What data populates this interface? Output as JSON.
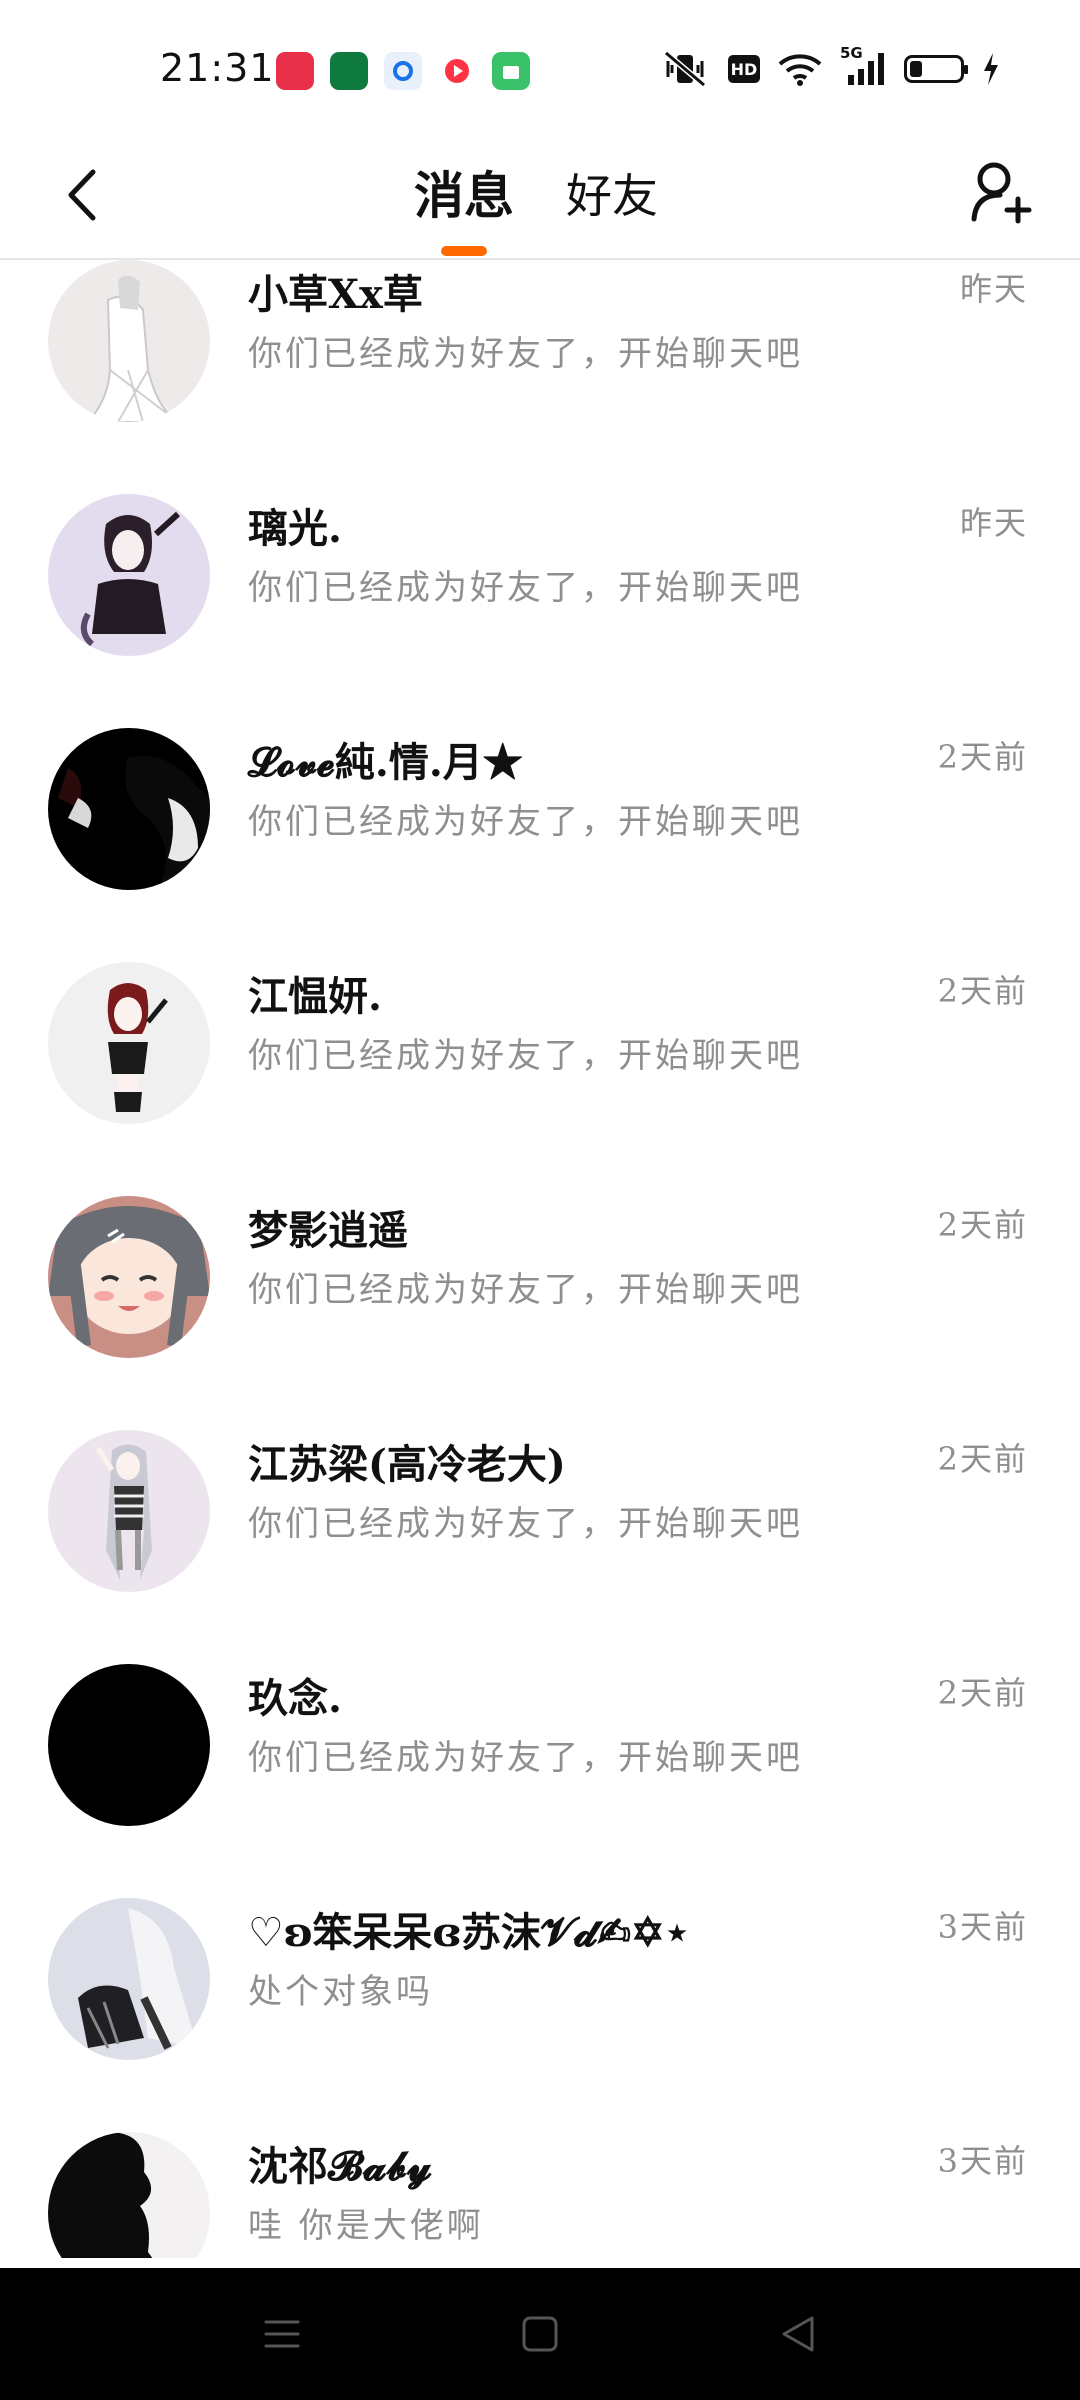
{
  "status_bar": {
    "time": "21:31",
    "app_icons": [
      {
        "name": "xiaohongshu-icon",
        "color": "#e8304a",
        "label": "小红书"
      },
      {
        "name": "oppo-icon",
        "color": "#0e7a3e",
        "label": "OPPO"
      },
      {
        "name": "qq-browser-icon",
        "color": "#e8f0fb",
        "label": ""
      },
      {
        "name": "video-app-icon",
        "color": "#ff3344",
        "label": ""
      },
      {
        "name": "app-store-icon",
        "color": "#39c26a",
        "label": ""
      }
    ],
    "network": "5G",
    "hd": "HD"
  },
  "header": {
    "tab_messages": "消息",
    "tab_friends": "好友",
    "accent_color": "#ff6a00"
  },
  "conversations": [
    {
      "name": "小草Xx草",
      "preview": "你们已经成为好友了，开始聊天吧",
      "time": "昨天"
    },
    {
      "name": "璃光.",
      "preview": "你们已经成为好友了，开始聊天吧",
      "time": "昨天"
    },
    {
      "name": "𝓛𝓸𝓿𝓮純.情.月★",
      "preview": "你们已经成为好友了，开始聊天吧",
      "time": "2天前"
    },
    {
      "name": "江愠妍.",
      "preview": "你们已经成为好友了，开始聊天吧",
      "time": "2天前"
    },
    {
      "name": "梦影逍遥",
      "preview": "你们已经成为好友了，开始聊天吧",
      "time": "2天前"
    },
    {
      "name": "江苏梁(高冷老大)",
      "preview": "你们已经成为好友了，开始聊天吧",
      "time": "2天前"
    },
    {
      "name": "玖念.",
      "preview": "你们已经成为好友了，开始聊天吧",
      "time": "2天前"
    },
    {
      "name": "♡ʚ笨呆呆ɞ苏沫𝓥𝓭✍︎✡︎⋆",
      "preview": "处个对象吗",
      "time": "3天前"
    },
    {
      "name": "沈祁𝓑𝓪𝓫𝔂",
      "preview": "哇 你是大佬啊",
      "time": "3天前"
    }
  ]
}
